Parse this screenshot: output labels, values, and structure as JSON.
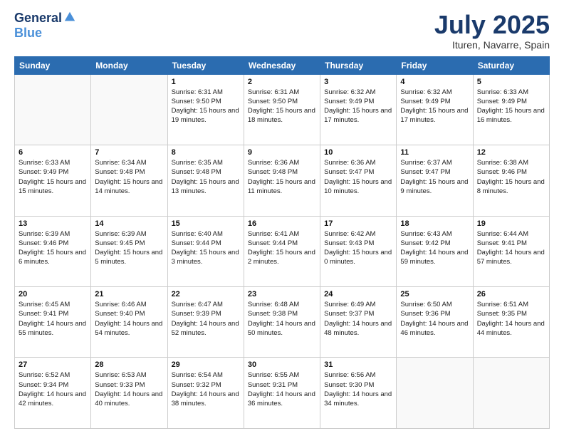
{
  "header": {
    "logo_line1": "General",
    "logo_line2": "Blue",
    "month": "July 2025",
    "location": "Ituren, Navarre, Spain"
  },
  "weekdays": [
    "Sunday",
    "Monday",
    "Tuesday",
    "Wednesday",
    "Thursday",
    "Friday",
    "Saturday"
  ],
  "weeks": [
    [
      {
        "day": "",
        "sunrise": "",
        "sunset": "",
        "daylight": ""
      },
      {
        "day": "",
        "sunrise": "",
        "sunset": "",
        "daylight": ""
      },
      {
        "day": "1",
        "sunrise": "Sunrise: 6:31 AM",
        "sunset": "Sunset: 9:50 PM",
        "daylight": "Daylight: 15 hours and 19 minutes."
      },
      {
        "day": "2",
        "sunrise": "Sunrise: 6:31 AM",
        "sunset": "Sunset: 9:50 PM",
        "daylight": "Daylight: 15 hours and 18 minutes."
      },
      {
        "day": "3",
        "sunrise": "Sunrise: 6:32 AM",
        "sunset": "Sunset: 9:49 PM",
        "daylight": "Daylight: 15 hours and 17 minutes."
      },
      {
        "day": "4",
        "sunrise": "Sunrise: 6:32 AM",
        "sunset": "Sunset: 9:49 PM",
        "daylight": "Daylight: 15 hours and 17 minutes."
      },
      {
        "day": "5",
        "sunrise": "Sunrise: 6:33 AM",
        "sunset": "Sunset: 9:49 PM",
        "daylight": "Daylight: 15 hours and 16 minutes."
      }
    ],
    [
      {
        "day": "6",
        "sunrise": "Sunrise: 6:33 AM",
        "sunset": "Sunset: 9:49 PM",
        "daylight": "Daylight: 15 hours and 15 minutes."
      },
      {
        "day": "7",
        "sunrise": "Sunrise: 6:34 AM",
        "sunset": "Sunset: 9:48 PM",
        "daylight": "Daylight: 15 hours and 14 minutes."
      },
      {
        "day": "8",
        "sunrise": "Sunrise: 6:35 AM",
        "sunset": "Sunset: 9:48 PM",
        "daylight": "Daylight: 15 hours and 13 minutes."
      },
      {
        "day": "9",
        "sunrise": "Sunrise: 6:36 AM",
        "sunset": "Sunset: 9:48 PM",
        "daylight": "Daylight: 15 hours and 11 minutes."
      },
      {
        "day": "10",
        "sunrise": "Sunrise: 6:36 AM",
        "sunset": "Sunset: 9:47 PM",
        "daylight": "Daylight: 15 hours and 10 minutes."
      },
      {
        "day": "11",
        "sunrise": "Sunrise: 6:37 AM",
        "sunset": "Sunset: 9:47 PM",
        "daylight": "Daylight: 15 hours and 9 minutes."
      },
      {
        "day": "12",
        "sunrise": "Sunrise: 6:38 AM",
        "sunset": "Sunset: 9:46 PM",
        "daylight": "Daylight: 15 hours and 8 minutes."
      }
    ],
    [
      {
        "day": "13",
        "sunrise": "Sunrise: 6:39 AM",
        "sunset": "Sunset: 9:46 PM",
        "daylight": "Daylight: 15 hours and 6 minutes."
      },
      {
        "day": "14",
        "sunrise": "Sunrise: 6:39 AM",
        "sunset": "Sunset: 9:45 PM",
        "daylight": "Daylight: 15 hours and 5 minutes."
      },
      {
        "day": "15",
        "sunrise": "Sunrise: 6:40 AM",
        "sunset": "Sunset: 9:44 PM",
        "daylight": "Daylight: 15 hours and 3 minutes."
      },
      {
        "day": "16",
        "sunrise": "Sunrise: 6:41 AM",
        "sunset": "Sunset: 9:44 PM",
        "daylight": "Daylight: 15 hours and 2 minutes."
      },
      {
        "day": "17",
        "sunrise": "Sunrise: 6:42 AM",
        "sunset": "Sunset: 9:43 PM",
        "daylight": "Daylight: 15 hours and 0 minutes."
      },
      {
        "day": "18",
        "sunrise": "Sunrise: 6:43 AM",
        "sunset": "Sunset: 9:42 PM",
        "daylight": "Daylight: 14 hours and 59 minutes."
      },
      {
        "day": "19",
        "sunrise": "Sunrise: 6:44 AM",
        "sunset": "Sunset: 9:41 PM",
        "daylight": "Daylight: 14 hours and 57 minutes."
      }
    ],
    [
      {
        "day": "20",
        "sunrise": "Sunrise: 6:45 AM",
        "sunset": "Sunset: 9:41 PM",
        "daylight": "Daylight: 14 hours and 55 minutes."
      },
      {
        "day": "21",
        "sunrise": "Sunrise: 6:46 AM",
        "sunset": "Sunset: 9:40 PM",
        "daylight": "Daylight: 14 hours and 54 minutes."
      },
      {
        "day": "22",
        "sunrise": "Sunrise: 6:47 AM",
        "sunset": "Sunset: 9:39 PM",
        "daylight": "Daylight: 14 hours and 52 minutes."
      },
      {
        "day": "23",
        "sunrise": "Sunrise: 6:48 AM",
        "sunset": "Sunset: 9:38 PM",
        "daylight": "Daylight: 14 hours and 50 minutes."
      },
      {
        "day": "24",
        "sunrise": "Sunrise: 6:49 AM",
        "sunset": "Sunset: 9:37 PM",
        "daylight": "Daylight: 14 hours and 48 minutes."
      },
      {
        "day": "25",
        "sunrise": "Sunrise: 6:50 AM",
        "sunset": "Sunset: 9:36 PM",
        "daylight": "Daylight: 14 hours and 46 minutes."
      },
      {
        "day": "26",
        "sunrise": "Sunrise: 6:51 AM",
        "sunset": "Sunset: 9:35 PM",
        "daylight": "Daylight: 14 hours and 44 minutes."
      }
    ],
    [
      {
        "day": "27",
        "sunrise": "Sunrise: 6:52 AM",
        "sunset": "Sunset: 9:34 PM",
        "daylight": "Daylight: 14 hours and 42 minutes."
      },
      {
        "day": "28",
        "sunrise": "Sunrise: 6:53 AM",
        "sunset": "Sunset: 9:33 PM",
        "daylight": "Daylight: 14 hours and 40 minutes."
      },
      {
        "day": "29",
        "sunrise": "Sunrise: 6:54 AM",
        "sunset": "Sunset: 9:32 PM",
        "daylight": "Daylight: 14 hours and 38 minutes."
      },
      {
        "day": "30",
        "sunrise": "Sunrise: 6:55 AM",
        "sunset": "Sunset: 9:31 PM",
        "daylight": "Daylight: 14 hours and 36 minutes."
      },
      {
        "day": "31",
        "sunrise": "Sunrise: 6:56 AM",
        "sunset": "Sunset: 9:30 PM",
        "daylight": "Daylight: 14 hours and 34 minutes."
      },
      {
        "day": "",
        "sunrise": "",
        "sunset": "",
        "daylight": ""
      },
      {
        "day": "",
        "sunrise": "",
        "sunset": "",
        "daylight": ""
      }
    ]
  ]
}
